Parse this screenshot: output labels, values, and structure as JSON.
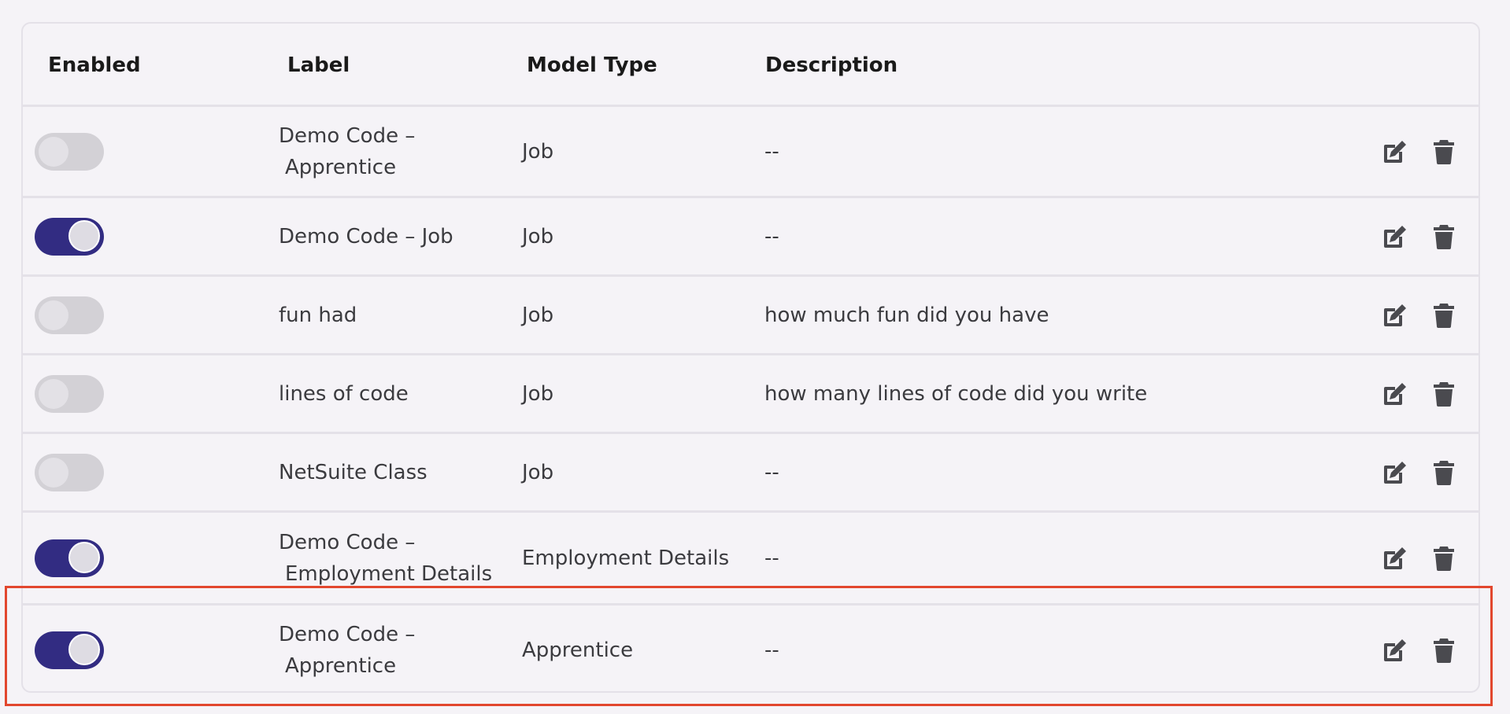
{
  "table": {
    "columns": {
      "enabled": "Enabled",
      "label": "Label",
      "model_type": "Model Type",
      "description": "Description"
    },
    "rows": [
      {
        "enabled": false,
        "label_line1": "Demo Code –",
        "label_line2": "Apprentice",
        "model_type": "Job",
        "description": "--"
      },
      {
        "enabled": true,
        "label_line1": "Demo Code – Job",
        "label_line2": "",
        "model_type": "Job",
        "description": "--"
      },
      {
        "enabled": false,
        "label_line1": "fun had",
        "label_line2": "",
        "model_type": "Job",
        "description": "how much fun did you have"
      },
      {
        "enabled": false,
        "label_line1": "lines of code",
        "label_line2": "",
        "model_type": "Job",
        "description": "how many lines of code did you write"
      },
      {
        "enabled": false,
        "label_line1": "NetSuite Class",
        "label_line2": "",
        "model_type": "Job",
        "description": "--"
      },
      {
        "enabled": true,
        "label_line1": "Demo Code –",
        "label_line2": "Employment Details",
        "model_type": "Employment Details",
        "description": "--"
      },
      {
        "enabled": true,
        "label_line1": "Demo Code –",
        "label_line2": "Apprentice",
        "model_type": "Apprentice",
        "description": "--"
      }
    ]
  },
  "icons": {
    "edit": "edit-icon",
    "delete": "trash-icon"
  },
  "colors": {
    "toggle_on": "#322c82",
    "toggle_off": "#d3d1d6",
    "highlight": "#e2472e",
    "icon": "#4a4a4f"
  }
}
